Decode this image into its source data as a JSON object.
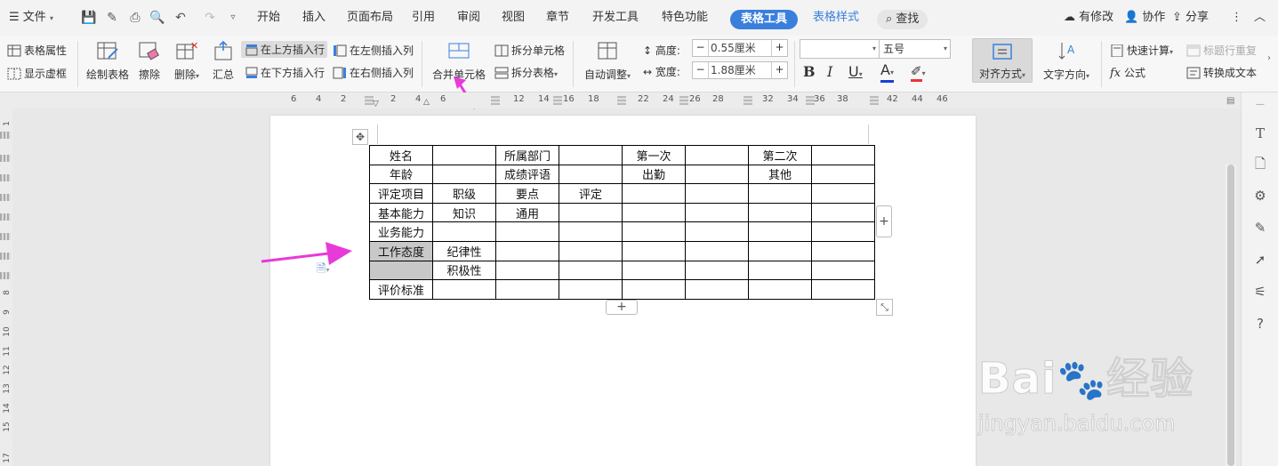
{
  "menubar": {
    "file_menu": "文件",
    "tabs": [
      "开始",
      "插入",
      "页面布局",
      "引用",
      "审阅",
      "视图",
      "章节",
      "开发工具",
      "特色功能"
    ],
    "active_tab": "表格工具",
    "table_style_tab": "表格样式",
    "search": "查找",
    "modified": "有修改",
    "collaborate": "协作",
    "share": "分享"
  },
  "ribbon": {
    "table_properties": "表格属性",
    "show_gridlines": "显示虚框",
    "draw_table": "绘制表格",
    "erase": "擦除",
    "delete": "删除",
    "summary": "汇总",
    "insert_above": "在上方插入行",
    "insert_below": "在下方插入行",
    "insert_left": "在左侧插入列",
    "insert_right": "在右侧插入列",
    "merge_cells": "合并单元格",
    "split_cells": "拆分单元格",
    "split_table": "拆分表格",
    "auto_fit": "自动调整",
    "height_label": "高度:",
    "height_value": "0.55厘米",
    "width_label": "宽度:",
    "width_value": "1.88厘米",
    "font_name": "",
    "font_size": "五号",
    "bold": "B",
    "italic": "I",
    "underline": "U",
    "font_color": "A",
    "align": "对齐方式",
    "text_direction": "文字方向",
    "quick_calc": "快速计算",
    "repeat_header": "标题行重复",
    "formula": "公式",
    "convert_text": "转换成文本"
  },
  "ruler": {
    "marks": [
      "6",
      "4",
      "2",
      "",
      "2",
      "4",
      "6",
      "",
      "",
      "12",
      "14",
      "16",
      "18",
      "",
      "22",
      "24",
      "26",
      "28",
      "",
      "32",
      "34",
      "36",
      "38",
      "",
      "42",
      "44",
      "46"
    ],
    "vmarks": [
      "1",
      "",
      "",
      "",
      "",
      "",
      "",
      "8",
      "9",
      "10",
      "11",
      "12",
      "13",
      "14",
      "15",
      "",
      "17"
    ]
  },
  "table": {
    "rows": [
      [
        "姓名",
        "",
        "所属部门",
        "",
        "第一次",
        "",
        "第二次",
        ""
      ],
      [
        "年龄",
        "",
        "成绩评语",
        "",
        "出勤",
        "",
        "其他",
        ""
      ],
      [
        "评定项目",
        "职级",
        "要点",
        "评定",
        "",
        "",
        "",
        ""
      ],
      [
        "基本能力",
        "知识",
        "通用",
        "",
        "",
        "",
        "",
        ""
      ],
      [
        "业务能力",
        "",
        "",
        "",
        "",
        "",
        "",
        ""
      ],
      [
        "工作态度",
        "纪律性",
        "",
        "",
        "",
        "",
        "",
        ""
      ],
      [
        "",
        "积极性",
        "",
        "",
        "",
        "",
        "",
        ""
      ],
      [
        "评价标准",
        "",
        "",
        "",
        "",
        "",
        "",
        ""
      ]
    ]
  },
  "watermark": {
    "brand": "Bai",
    "brand_suffix": "经验",
    "url": "jingyan.baidu.com"
  },
  "colors": {
    "accent": "#3a7fdc",
    "arrow": "#e83ad8",
    "selection": "#c8c8c8"
  }
}
